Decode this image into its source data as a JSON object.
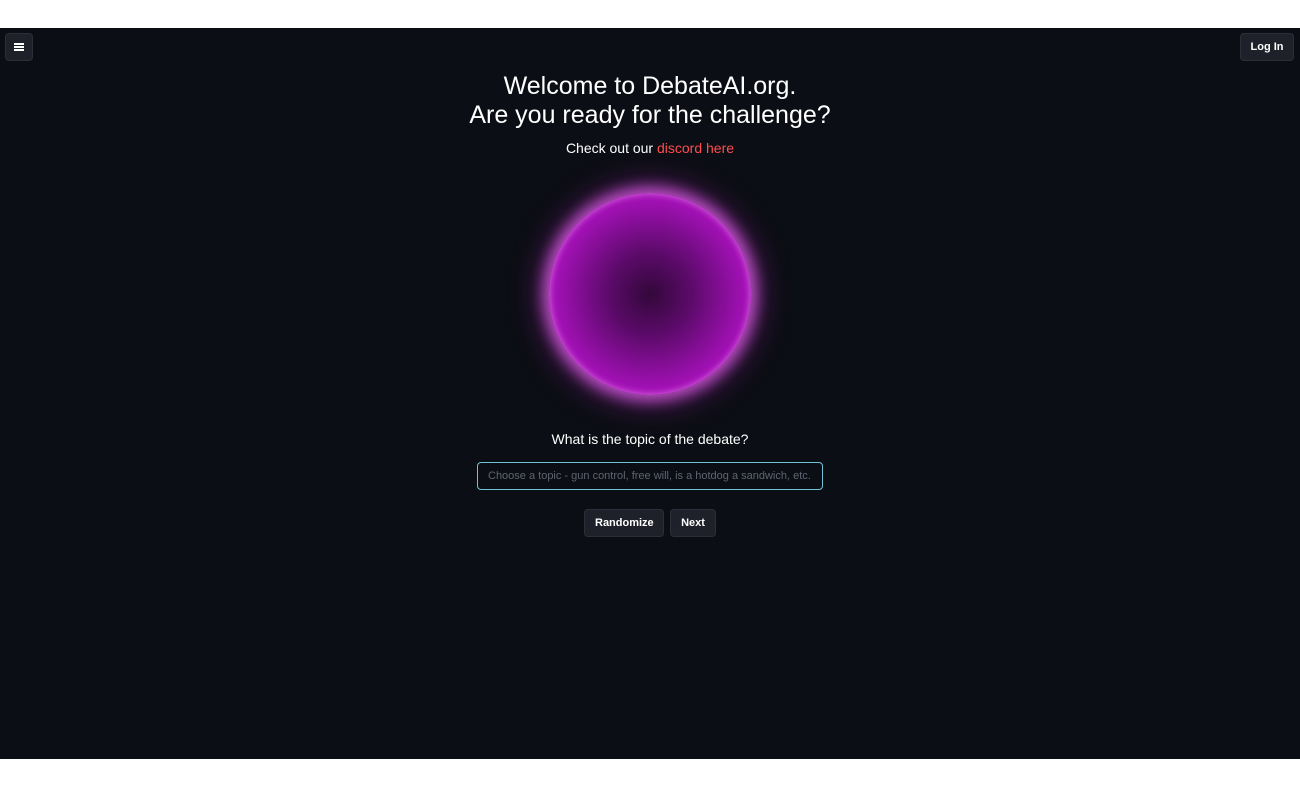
{
  "header": {
    "menu_icon": "hamburger-menu-icon",
    "login_label": "Log In"
  },
  "hero": {
    "title_line1": "Welcome to DebateAI.org.",
    "title_line2": "Are you ready for the challenge?",
    "discord_prefix": "Check out our ",
    "discord_link": "discord here"
  },
  "topic": {
    "question": "What is the topic of the debate?",
    "placeholder": "Choose a topic - gun control, free will, is a hotdog a sandwich, etc.",
    "value": ""
  },
  "actions": {
    "randomize_label": "Randomize",
    "next_label": "Next"
  },
  "colors": {
    "background": "#0c0e15",
    "link": "#ff4d4d",
    "input_border": "#6ec3d6",
    "orb": "#c514d6"
  }
}
